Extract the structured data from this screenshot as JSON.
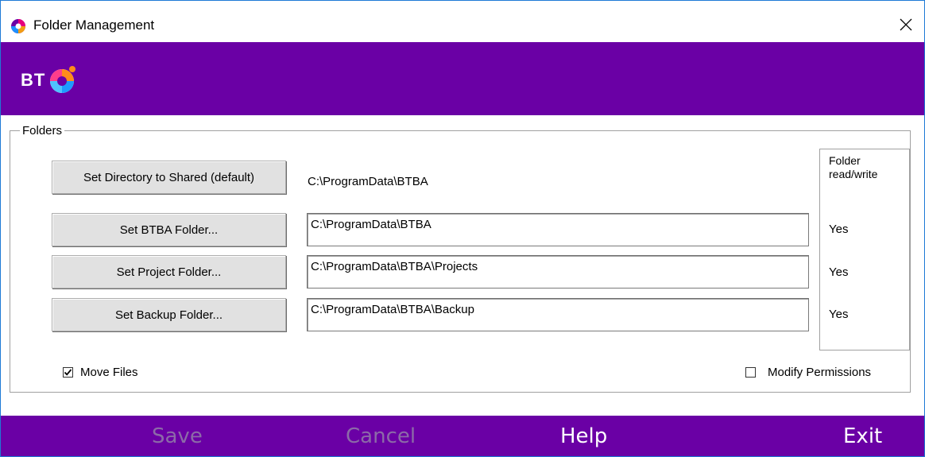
{
  "window": {
    "title": "Folder Management",
    "close_glyph": "✕"
  },
  "brand": {
    "logo_text": "BT",
    "background": "#6a00a5"
  },
  "folders": {
    "legend": "Folders",
    "shared_button": "Set Directory to Shared (default)",
    "shared_path": "C:\\ProgramData\\BTBA",
    "rows": [
      {
        "button": "Set BTBA Folder...",
        "path": "C:\\ProgramData\\BTBA",
        "rw": "Yes"
      },
      {
        "button": "Set Project Folder...",
        "path": "C:\\ProgramData\\BTBA\\Projects",
        "rw": "Yes"
      },
      {
        "button": "Set Backup Folder...",
        "path": "C:\\ProgramData\\BTBA\\Backup",
        "rw": "Yes"
      }
    ],
    "rw_header_line1": "Folder",
    "rw_header_line2": "read/write"
  },
  "options": {
    "move_files_label": "Move Files",
    "move_files_checked": true,
    "modify_permissions_label": "Modify Permissions",
    "modify_permissions_checked": false,
    "check_glyph": "✓"
  },
  "footer": {
    "save": "Save",
    "cancel": "Cancel",
    "help": "Help",
    "exit": "Exit",
    "disabled_color": "#8c6aa8",
    "enabled_color": "#ffffff"
  }
}
